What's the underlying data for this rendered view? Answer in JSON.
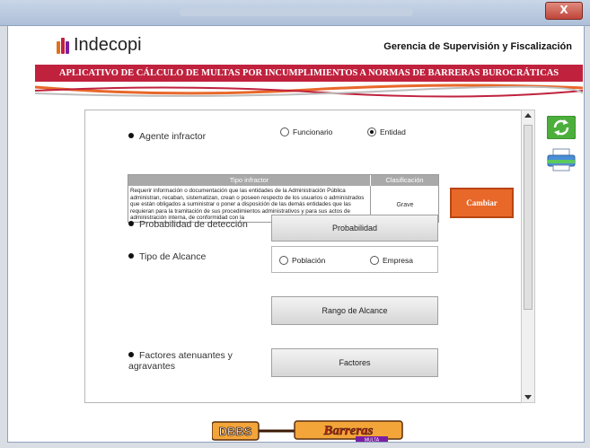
{
  "window": {
    "close_label": "X"
  },
  "header": {
    "logo_text": "Indecopi",
    "gerencia": "Gerencia de Supervisión y Fiscalización",
    "banner": "APLICATIVO DE CÁLCULO DE MULTAS POR INCUMPLIMIENTOS A NORMAS DE BARRERAS BUROCRÁTICAS"
  },
  "form": {
    "agente_label": "Agente infractor",
    "agente_options": [
      {
        "label": "Funcionario",
        "selected": false
      },
      {
        "label": "Entidad",
        "selected": true
      }
    ],
    "table": {
      "col_tipo": "Tipo infractor",
      "col_clasificacion": "Clasificación",
      "tipo_text": "Requerir información o documentación que las entidades de la Administración Pública administran, recaban, sistematizan, crean o poseen respecto de los usuarios o administrados que están obligados a suministrar o poner a disposición de las demás entidades que las requieran para la tramitación de sus procedimientos administrativos y para sus actos de administración interna, de conformidad con la",
      "clasificacion": "Grave"
    },
    "cambiar_label": "Cambiar",
    "probabilidad_label": "Probabilidad de detección",
    "probabilidad_button": "Probabilidad",
    "alcance_label": "Tipo de Alcance",
    "alcance_options": [
      {
        "label": "Población",
        "selected": false
      },
      {
        "label": "Empresa",
        "selected": false
      }
    ],
    "rango_button": "Rango de Alcance",
    "factores_label": "Factores atenuantes y agravantes",
    "factores_button": "Factores"
  },
  "footer": {
    "logo_text_left": "DBBS",
    "logo_text_right": "Barreras",
    "logo_tag": "MULTA"
  },
  "colors": {
    "brand_red": "#c0223e",
    "accent_orange": "#e8682a",
    "icon_green": "#4caf3c"
  }
}
